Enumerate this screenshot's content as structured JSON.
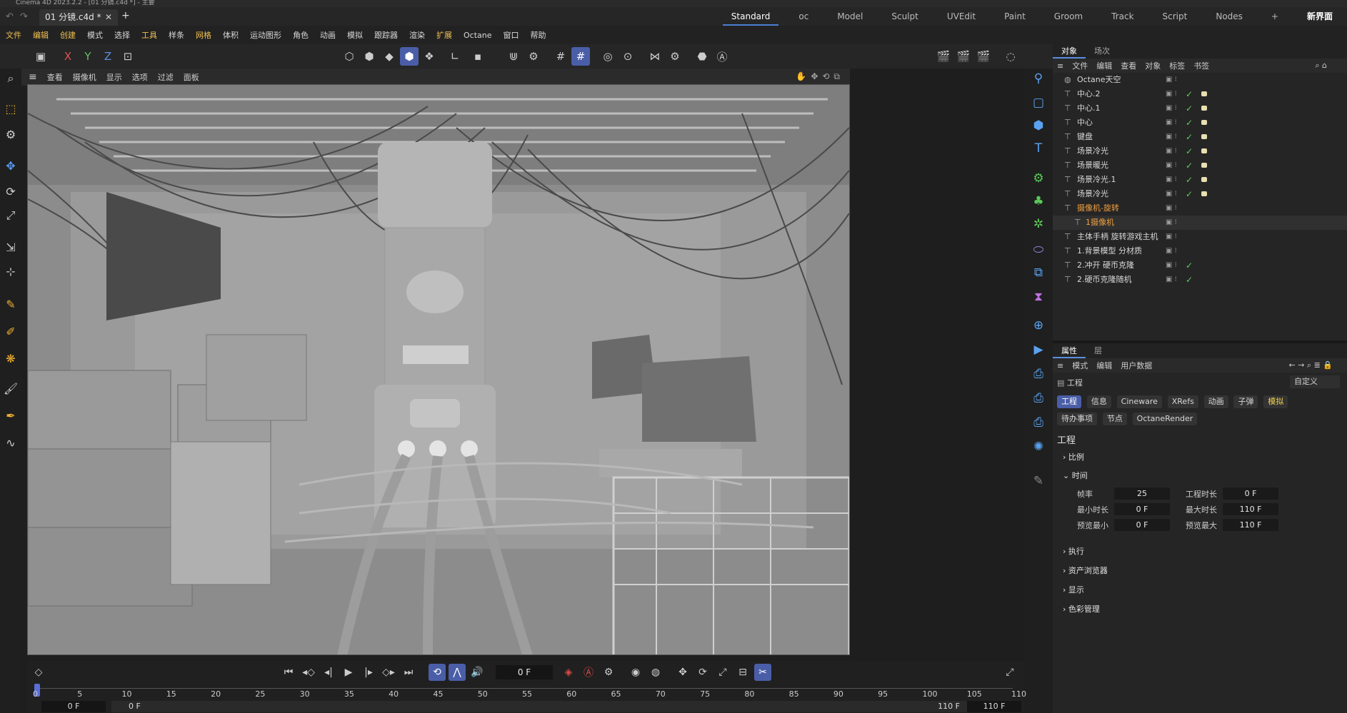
{
  "titlebar": {
    "text": "Cinema 4D 2023.2.2 - [01 分镜.c4d *] - 主要"
  },
  "doc_tab": {
    "label": "01 分镜.c4d *"
  },
  "layouts": [
    "Standard",
    "oc",
    "Model",
    "Sculpt",
    "UVEdit",
    "Paint",
    "Groom",
    "Track",
    "Script",
    "Nodes",
    "+",
    "新界面"
  ],
  "menu": [
    "文件",
    "编辑",
    "创建",
    "模式",
    "选择",
    "工具",
    "样条",
    "网格",
    "体积",
    "运动图形",
    "角色",
    "动画",
    "模拟",
    "跟踪器",
    "渲染",
    "扩展",
    "Octane",
    "窗口",
    "帮助"
  ],
  "axis": {
    "x": "X",
    "y": "Y",
    "z": "Z"
  },
  "viewport_menu": [
    "查看",
    "摄像机",
    "显示",
    "选项",
    "过滤",
    "面板"
  ],
  "obj_panel": {
    "tabs": [
      "对象",
      "场次"
    ],
    "menu": [
      "文件",
      "编辑",
      "查看",
      "对象",
      "标签",
      "书签"
    ],
    "items": [
      {
        "name": "Octane天空",
        "tag": "sky"
      },
      {
        "name": "中心.2",
        "check": true
      },
      {
        "name": "中心.1",
        "check": true
      },
      {
        "name": "中心",
        "check": true
      },
      {
        "name": "键盘",
        "check": true
      },
      {
        "name": "场景冷光",
        "check": true
      },
      {
        "name": "场景暖光",
        "check": true
      },
      {
        "name": "场景冷光.1",
        "check": true
      },
      {
        "name": "场景冷光",
        "check": true
      },
      {
        "name": "摄像机-旋转",
        "color": "orange"
      },
      {
        "name": "1摄像机",
        "color": "orange-sel"
      },
      {
        "name": "主体手柄 旋转游戏主机"
      },
      {
        "name": "1.背景模型 分材质"
      },
      {
        "name": "2.冲开 硬币克隆",
        "check": true
      },
      {
        "name": "2.硬币克隆随机",
        "check": true
      }
    ]
  },
  "attr_panel": {
    "tabs": [
      "属性",
      "层"
    ],
    "menu": [
      "模式",
      "编辑",
      "用户数据"
    ],
    "object": "工程",
    "preset": "自定义",
    "buttons_row1": [
      "工程",
      "信息",
      "Cineware",
      "XRefs",
      "动画",
      "子弹",
      "模拟"
    ],
    "buttons_row2": [
      "待办事项",
      "节点",
      "OctaneRender"
    ],
    "heading": "工程",
    "sections": [
      "比例",
      "时间",
      "执行",
      "资产浏览器",
      "显示",
      "色彩管理"
    ],
    "fields": {
      "fps_label": "帧率",
      "fps": "25",
      "proj_len_label": "工程时长",
      "proj_len": "0 F",
      "min_label": "最小时长",
      "min": "0 F",
      "max_label": "最大时长",
      "max": "110 F",
      "pmin_label": "预览最小",
      "pmin": "0 F",
      "pmax_label": "预览最大",
      "pmax": "110 F"
    }
  },
  "timeline": {
    "current_frame": "0 F",
    "ticks": [
      "0",
      "5",
      "10",
      "15",
      "20",
      "25",
      "30",
      "35",
      "40",
      "45",
      "50",
      "55",
      "60",
      "65",
      "70",
      "75",
      "80",
      "85",
      "90",
      "95",
      "100",
      "105",
      "110"
    ],
    "range_start": "0 F",
    "range_start2": "0 F",
    "range_end": "110 F",
    "range_end2": "110 F"
  }
}
